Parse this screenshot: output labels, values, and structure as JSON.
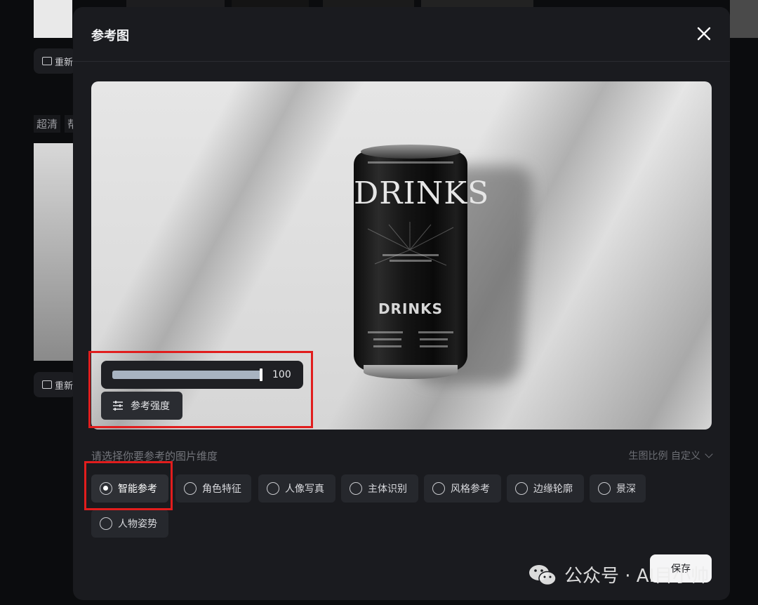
{
  "background": {
    "edit_chip_label": "重新",
    "quality_label": "超清",
    "quality_label_2": "帮"
  },
  "modal": {
    "title": "参考图",
    "strength": {
      "value": 100,
      "value_text": "100",
      "button_label": "参考强度"
    },
    "dimension_prompt": "请选择你要参考的图片维度",
    "ratio_label": "生图比例 自定义",
    "options": [
      {
        "label": "智能参考",
        "selected": true
      },
      {
        "label": "角色特征",
        "selected": false
      },
      {
        "label": "人像写真",
        "selected": false
      },
      {
        "label": "主体识别",
        "selected": false
      },
      {
        "label": "风格参考",
        "selected": false
      },
      {
        "label": "边缘轮廓",
        "selected": false
      },
      {
        "label": "景深",
        "selected": false
      },
      {
        "label": "人物姿势",
        "selected": false
      }
    ],
    "save_label": "保存"
  },
  "product_image": {
    "brand": "DRINKS",
    "brand_small": "DRINKS"
  },
  "watermark": {
    "text": "公众号 · AI目小帅"
  },
  "colors": {
    "highlight": "#e11d1d",
    "modal_bg": "#1a1b1f",
    "slider_fill": "#a8b3c1"
  }
}
